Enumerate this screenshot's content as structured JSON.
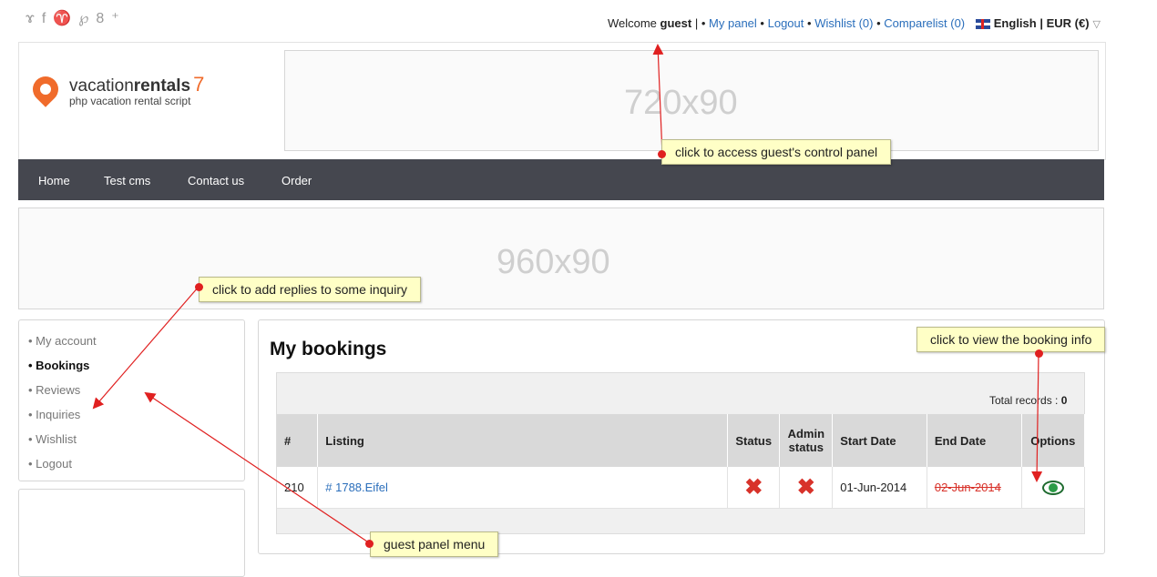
{
  "social": {
    "icons": [
      "rss-icon",
      "facebook-icon",
      "twitter-icon",
      "pinterest-icon",
      "googleplus-icon"
    ],
    "glyphs": [
      "ɤ",
      "f",
      "♈",
      "℘",
      "8⁺"
    ]
  },
  "topbar": {
    "welcome": "Welcome",
    "user": "guest",
    "sep1": "|",
    "bullet": "•",
    "my_panel": "My panel",
    "logout": "Logout",
    "wishlist": "Wishlist (0)",
    "comparelist": "Comparelist (0)",
    "locale": "English | EUR (€)"
  },
  "logo": {
    "name_light": "vacation",
    "name_bold": "rentals",
    "version": "7",
    "tagline": "php vacation rental script"
  },
  "banner_top": "720x90",
  "nav": {
    "items": [
      "Home",
      "Test cms",
      "Contact us",
      "Order"
    ]
  },
  "banner_mid": "960x90",
  "side_menu": {
    "items": [
      "• My account",
      "• Bookings",
      "• Reviews",
      "• Inquiries",
      "• Wishlist",
      "• Logout"
    ],
    "active_index": 1
  },
  "main": {
    "title": "My bookings",
    "total_label": "Total records :",
    "total_value": "0",
    "columns": [
      "#",
      "Listing",
      "Status",
      "Admin status",
      "Start Date",
      "End Date",
      "Options"
    ],
    "rows": [
      {
        "id": "210",
        "listing": "# 1788.Eifel",
        "status": "✖",
        "admin_status": "✖",
        "start": "01-Jun-2014",
        "end": "02-Jun-2014",
        "option": "eye-icon"
      }
    ]
  },
  "callouts": {
    "panel": "click to access guest's control panel",
    "inquiry": "click to add replies to some inquiry",
    "booking": "click to view the booking info",
    "menu": "guest panel menu"
  },
  "colors": {
    "accent": "#f06b2b",
    "nav_bg": "#45474f",
    "link": "#2a6ebb",
    "callout_bg": "#ffffc6",
    "arrow": "#e02020"
  }
}
